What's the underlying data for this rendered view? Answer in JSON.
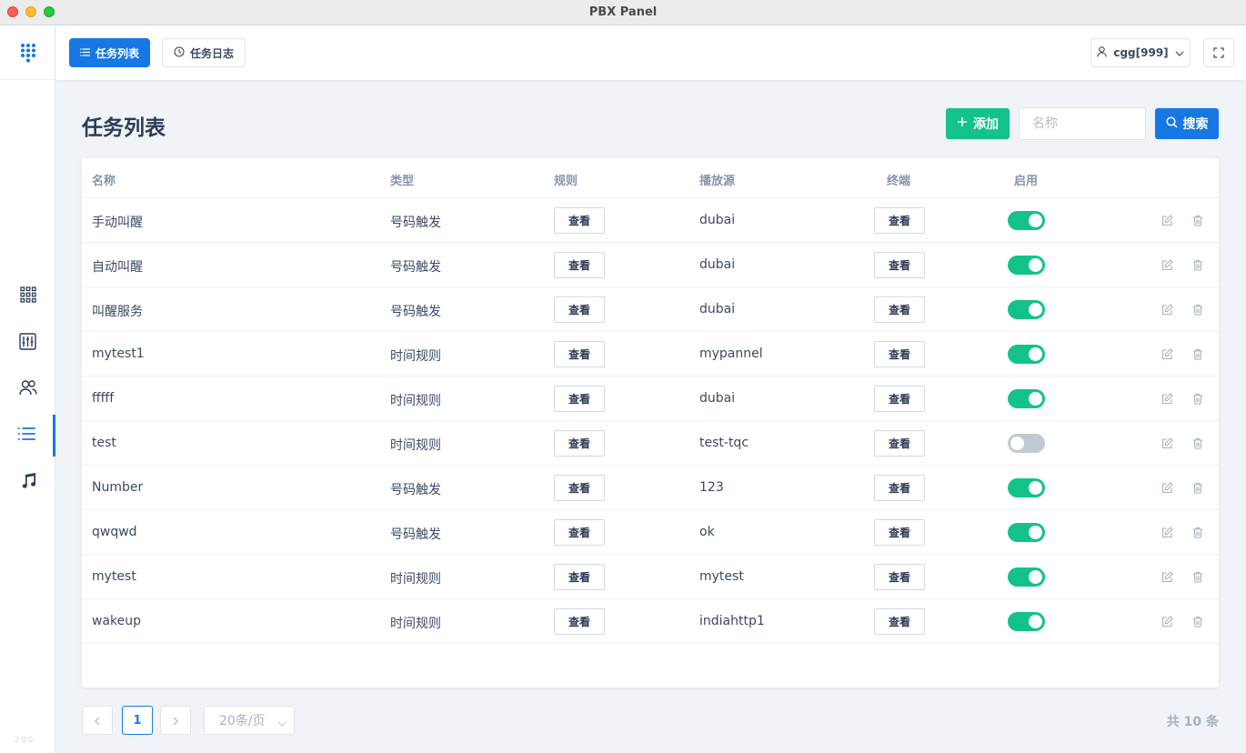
{
  "window": {
    "title": "PBX Panel"
  },
  "sidebar": {
    "footer_text": "2.0.0",
    "items": [
      {
        "icon": "grid-apps-icon"
      },
      {
        "icon": "mixer-sliders-icon"
      },
      {
        "icon": "users-icon"
      },
      {
        "icon": "list-icon",
        "active": true
      },
      {
        "icon": "music-note-icon"
      }
    ]
  },
  "topbar": {
    "tabs": [
      {
        "label": "任务列表",
        "icon": "list-icon",
        "active": true
      },
      {
        "label": "任务日志",
        "icon": "clock-icon",
        "active": false
      }
    ],
    "user_label": "cgg[999]"
  },
  "page": {
    "title": "任务列表",
    "add_label": "添加",
    "search_placeholder": "名称",
    "search_value": "",
    "search_label": "搜索"
  },
  "table": {
    "columns": [
      "名称",
      "类型",
      "规则",
      "播放源",
      "终端",
      "启用"
    ],
    "view_label": "查看",
    "rows": [
      {
        "name": "手动叫醒",
        "type": "号码触发",
        "source": "dubai",
        "enabled": true
      },
      {
        "name": "自动叫醒",
        "type": "号码触发",
        "source": "dubai",
        "enabled": true
      },
      {
        "name": "叫醒服务",
        "type": "号码触发",
        "source": "dubai",
        "enabled": true
      },
      {
        "name": "mytest1",
        "type": "时间规则",
        "source": "mypannel",
        "enabled": true
      },
      {
        "name": "fffff",
        "type": "时间规则",
        "source": "dubai",
        "enabled": true
      },
      {
        "name": "test",
        "type": "时间规则",
        "source": "test-tqc",
        "enabled": false
      },
      {
        "name": "Number",
        "type": "号码触发",
        "source": "123",
        "enabled": true
      },
      {
        "name": "qwqwd",
        "type": "号码触发",
        "source": "ok",
        "enabled": true
      },
      {
        "name": "mytest",
        "type": "时间规则",
        "source": "mytest",
        "enabled": true
      },
      {
        "name": "wakeup",
        "type": "时间规则",
        "source": "indiahttp1",
        "enabled": true
      }
    ]
  },
  "pagination": {
    "current_page": "1",
    "page_size": "20条/页",
    "total": "共 10 条"
  },
  "colors": {
    "primary": "#1677e5",
    "success": "#13c28a",
    "toggle_off": "#c2c9d2"
  }
}
